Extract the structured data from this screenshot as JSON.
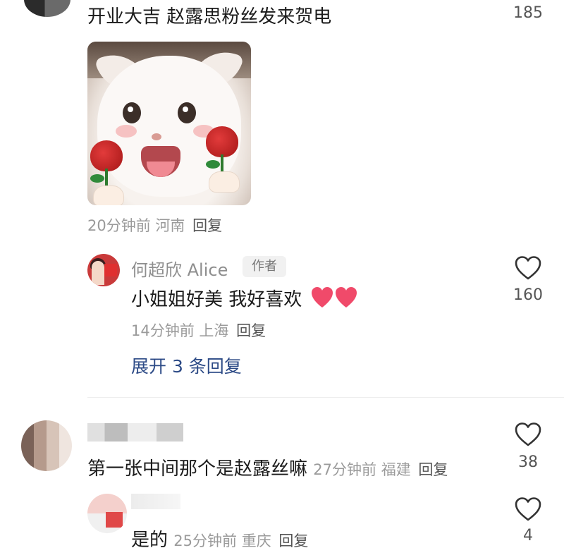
{
  "comment_top": {
    "text": "开业大吉 赵露思粉丝发来贺电",
    "likes": "185",
    "time": "20分钟前",
    "location": "河南",
    "reply_label": "回复"
  },
  "reply_alice": {
    "username": "何超欣 Alice",
    "badge": "作者",
    "text": "小姐姐好美 我好喜欢",
    "likes": "160",
    "time": "14分钟前",
    "location": "上海",
    "reply_label": "回复",
    "emoji": "❤️❤️"
  },
  "expand_replies": {
    "label": "展开 3 条回复"
  },
  "comment_2": {
    "text": "第一张中间那个是赵露丝嘛",
    "time": "27分钟前",
    "location": "福建",
    "reply_label": "回复",
    "likes": "38"
  },
  "comment_3": {
    "text": "是的",
    "time": "25分钟前",
    "location": "重庆",
    "reply_label": "回复",
    "likes": "4"
  },
  "colors": {
    "expand_link": "#2c4a86",
    "heart_emoji": "#f04a6a",
    "meta_text": "#9a9a9a"
  },
  "icons": {
    "like": "heart-outline-icon"
  }
}
